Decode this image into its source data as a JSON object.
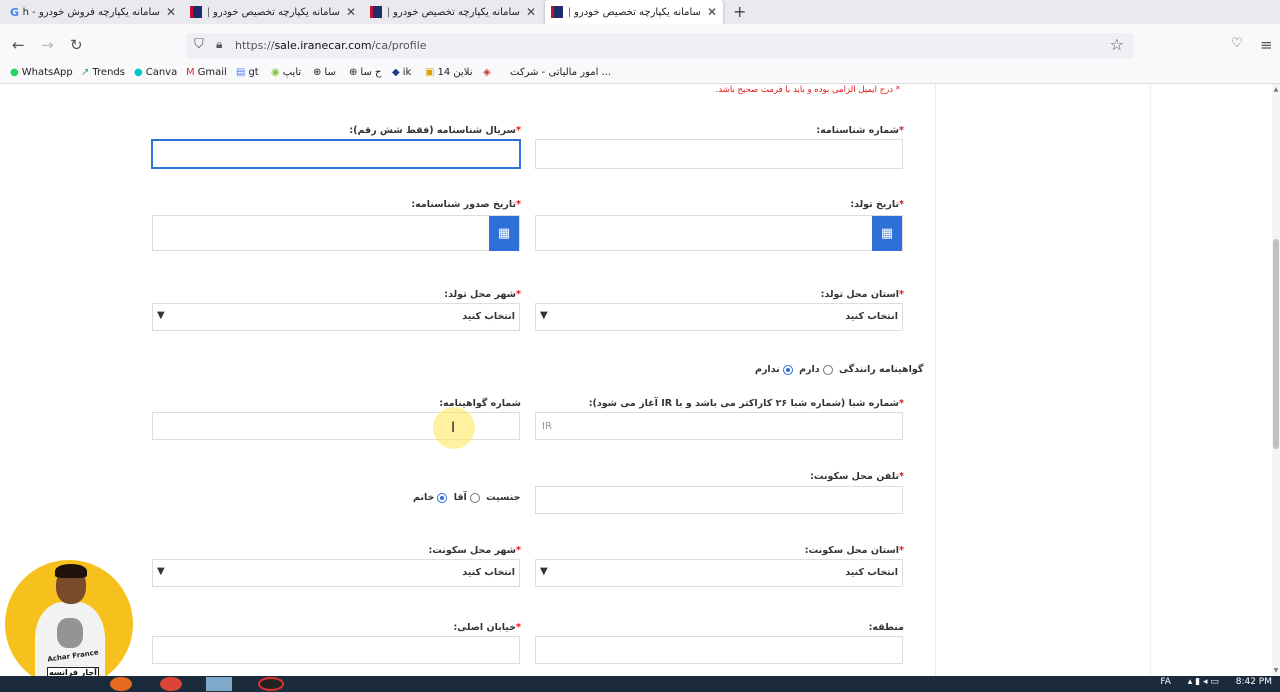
{
  "tabs": [
    {
      "title": "سامانه یکپارچه فروش خودرو - rch",
      "icon": "google-icon",
      "active": false
    },
    {
      "title": "سامانه یکپارچه تخصیص خودرو | ...",
      "icon": "site-icon",
      "active": false
    },
    {
      "title": "سامانه یکپارچه تخصیص خودرو | ...",
      "icon": "site-icon",
      "active": false
    },
    {
      "title": "سامانه یکپارچه تخصیص خودرو | ...",
      "icon": "site-icon",
      "active": true
    }
  ],
  "address": {
    "prefix": "https://",
    "domain": "sale.iranecar.com",
    "path": "/ca/profile"
  },
  "bookmarks": [
    {
      "label": "WhatsApp",
      "icon": "whatsapp-icon"
    },
    {
      "label": "Trends",
      "icon": "trends-icon"
    },
    {
      "label": "Canva",
      "icon": "canva-icon"
    },
    {
      "label": "Gmail",
      "icon": "gmail-icon"
    },
    {
      "label": "gt",
      "icon": "translate-icon"
    },
    {
      "label": "تایپ",
      "icon": "type-icon"
    },
    {
      "label": "سا",
      "icon": "globe-icon"
    },
    {
      "label": "ح سا",
      "icon": "globe-icon"
    },
    {
      "label": "ik",
      "icon": "ik-icon"
    },
    {
      "label": "14 نلاین",
      "icon": "folder-icon"
    },
    {
      "label": "",
      "icon": "page-icon"
    },
    {
      "label": "امور مالیاتی - شرکت ...",
      "icon": ""
    }
  ],
  "form": {
    "email_error": "* درج ایمیل الزامی بوده و باید با فرمت صحیح باشد.",
    "id_number_label": "شماره شناسنامه:",
    "id_serial_label": "سریال شناسنامه (فقط شش رقم):",
    "birth_date_label": "تاریخ تولد:",
    "issue_date_label": "تاریخ صدور شناسنامه:",
    "birth_province_label": "استان محل تولد:",
    "birth_province_value": "انتخاب کنید",
    "birth_city_label": "شهر محل تولد:",
    "birth_city_value": "انتخاب کنید",
    "license_label": "گواهینامه رانندگی",
    "license_yes": "دارم",
    "license_no": "ندارم",
    "sheba_label": "شماره شبا (شماره شبا ۲۶ کاراکتر می باشد و با IR آغاز می شود):",
    "sheba_placeholder": "IR",
    "license_number_label": "شماره گواهینامه:",
    "home_phone_label": "تلفن محل سکونت:",
    "gender_label": "جنسیت",
    "gender_male": "آقا",
    "gender_female": "خانم",
    "residence_province_label": "استان محل سکونت:",
    "residence_province_value": "انتخاب کنید",
    "residence_city_label": "شهر محل سکونت:",
    "residence_city_value": "انتخاب کنید",
    "region_label": "منطقه:",
    "main_street_label": "خیابان اصلی:",
    "required_mark": "*"
  },
  "overlay": {
    "brand_en": "Achar France",
    "brand_fa": "آچار فرانسه"
  },
  "taskbar": {
    "lang": "FA",
    "time": "8:42 PM"
  },
  "colors": {
    "accent": "#2f6fd8",
    "error": "#e01515"
  }
}
